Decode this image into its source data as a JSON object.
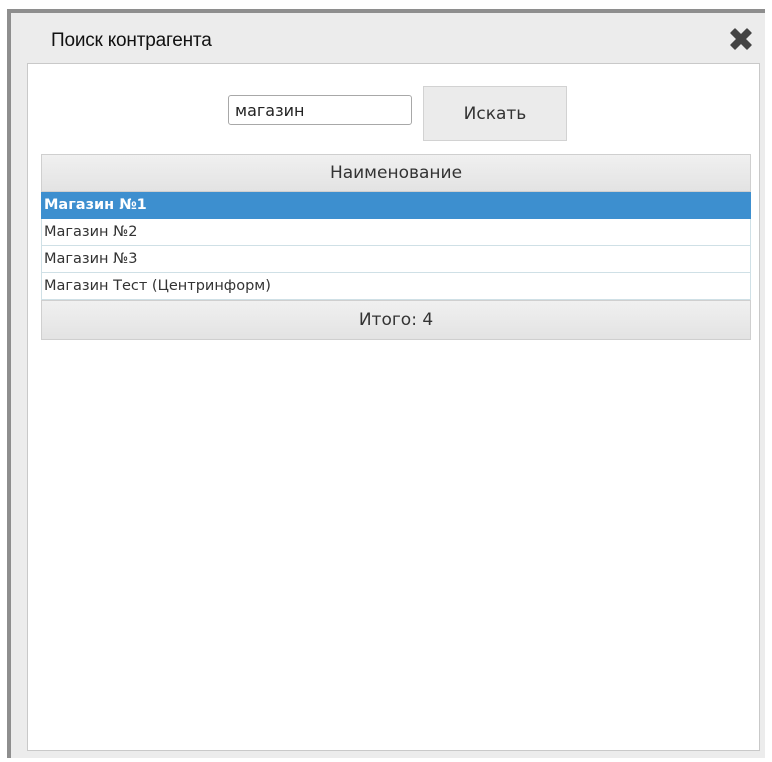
{
  "dialog": {
    "title": "Поиск контрагента",
    "close_icon": "close-x-icon"
  },
  "search": {
    "value": "магазин",
    "placeholder": "",
    "button_label": "Искать"
  },
  "grid": {
    "column_header": "Наименование",
    "rows": [
      {
        "name": "Магазин №1",
        "selected": true
      },
      {
        "name": "Магазин №2",
        "selected": false
      },
      {
        "name": "Магазин №3",
        "selected": false
      },
      {
        "name": "Магазин Тест (Центринформ)",
        "selected": false
      }
    ],
    "footer": "Итого: 4"
  },
  "colors": {
    "selection": "#3d8fcf",
    "frame": "#8e8e8e",
    "titlebar": "#ececec"
  }
}
